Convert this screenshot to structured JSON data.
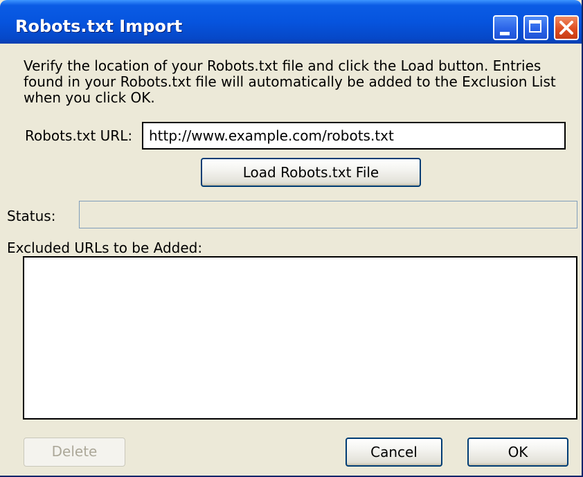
{
  "window": {
    "title": "Robots.txt Import",
    "buttons": {
      "minimize_icon": "minimize-icon",
      "maximize_icon": "maximize-icon",
      "close_icon": "close-icon"
    }
  },
  "description": "Verify the location of your Robots.txt file and click the Load button. Entries found in your Robots.txt file will automatically be added to the Exclusion List when you click OK.",
  "url_field": {
    "label": "Robots.txt URL:",
    "value": "http://www.example.com/robots.txt"
  },
  "load_button": {
    "label": "Load Robots.txt File"
  },
  "status": {
    "label": "Status:",
    "value": ""
  },
  "excluded": {
    "label": "Excluded URLs to be Added:",
    "items": []
  },
  "footer": {
    "delete_label": "Delete",
    "cancel_label": "Cancel",
    "ok_label": "OK"
  },
  "colors": {
    "titlebar": "#0654de",
    "window_bg": "#ece9d8",
    "close_button": "#de4e22"
  }
}
